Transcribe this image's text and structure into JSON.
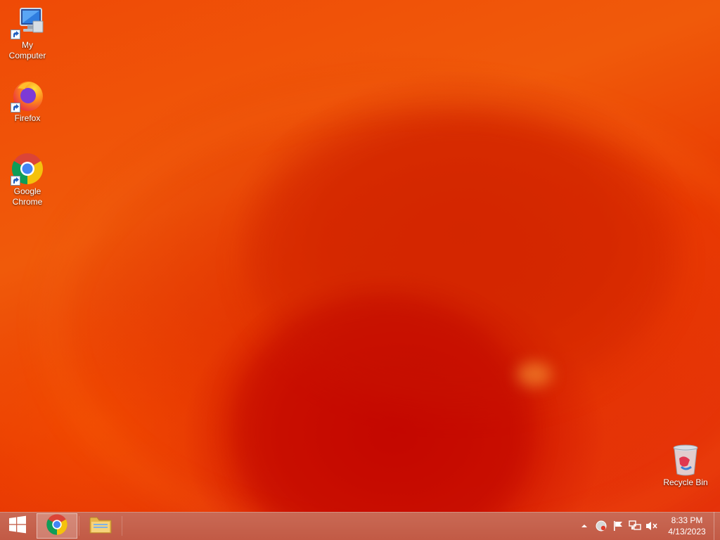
{
  "desktop": {
    "icons": [
      {
        "label": "My Computer",
        "icon": "computer-icon"
      },
      {
        "label": "Firefox",
        "icon": "firefox-icon"
      },
      {
        "label": "Google Chrome",
        "icon": "chrome-icon"
      },
      {
        "label": "Recycle Bin",
        "icon": "recycle-bin-icon"
      }
    ]
  },
  "taskbar": {
    "start_icon": "windows-logo-icon",
    "pinned": [
      {
        "name": "Google Chrome",
        "icon": "chrome-icon",
        "active": true
      },
      {
        "name": "File Explorer",
        "icon": "folder-icon",
        "active": false
      }
    ],
    "tray": {
      "icons": [
        "chevron-up-icon",
        "network-globe-icon",
        "action-center-flag-icon",
        "network-icon",
        "volume-muted-icon"
      ]
    },
    "clock": {
      "time": "8:33 PM",
      "date": "4/13/2023"
    }
  },
  "colors": {
    "wallpaper_primary": "#ef4a06",
    "wallpaper_dark": "#c80a00",
    "taskbar": "#c25a45"
  }
}
